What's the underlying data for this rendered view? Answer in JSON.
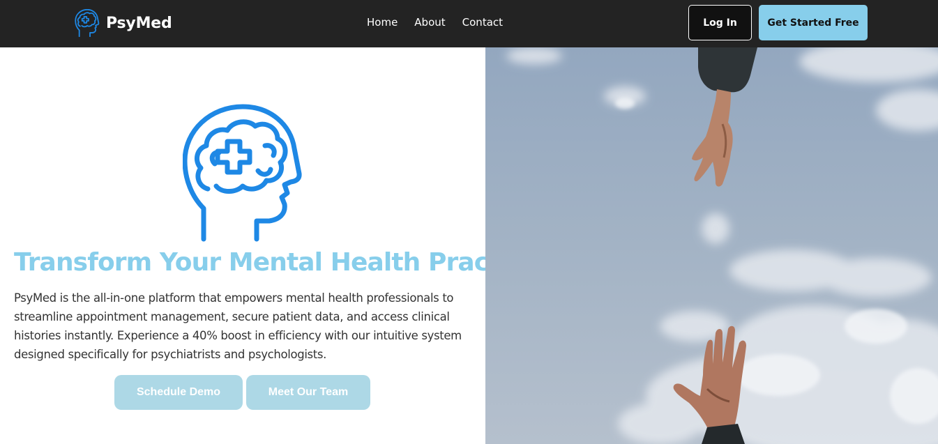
{
  "nav": {
    "brand": "PsyMed",
    "logo_icon": "brain-head-icon",
    "links": [
      {
        "label": "Home"
      },
      {
        "label": "About"
      },
      {
        "label": "Contact"
      }
    ],
    "login_label": "Log In",
    "cta_label": "Get Started Free"
  },
  "hero": {
    "icon": "brain-medical-head-icon",
    "title": "Transform Your Mental Health Practice",
    "description": "PsyMed is the all-in-one platform that empowers mental health professionals to streamline appointment management, secure patient data, and access clinical histories instantly. Experience a 40% boost in efficiency with our intuitive system designed specifically for psychiatrists and psychologists.",
    "buttons": {
      "demo": "Schedule Demo",
      "team": "Meet Our Team"
    },
    "image": "reaching-hands-sky-photo"
  },
  "colors": {
    "navbar": "#232323",
    "accent": "#87ceeb",
    "cta": "#add8e6",
    "icon_blue": "#1e88e5"
  }
}
